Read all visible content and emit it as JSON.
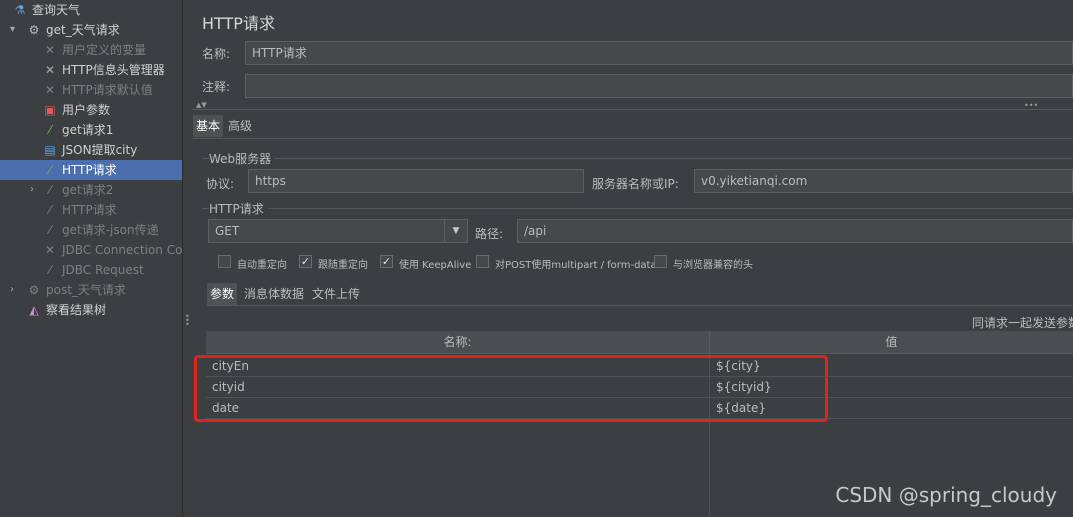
{
  "tree": {
    "items": [
      {
        "label": "查询天气",
        "icon": "flask-icon",
        "level": 0,
        "arrow": "",
        "state": "normal"
      },
      {
        "label": "get_天气请求",
        "icon": "gear-icon",
        "level": 1,
        "arrow": "▾",
        "state": "normal"
      },
      {
        "label": "用户定义的变量",
        "icon": "wrench-icon",
        "level": 2,
        "arrow": "",
        "state": "disabled"
      },
      {
        "label": "HTTP信息头管理器",
        "icon": "wrench-icon",
        "level": 2,
        "arrow": "",
        "state": "normal"
      },
      {
        "label": "HTTP请求默认值",
        "icon": "wrench-icon",
        "level": 2,
        "arrow": "",
        "state": "disabled"
      },
      {
        "label": "用户参数",
        "icon": "preprocessor-icon",
        "level": 2,
        "arrow": "",
        "state": "normal"
      },
      {
        "label": "get请求1",
        "icon": "pipette-icon",
        "level": 2,
        "arrow": "",
        "state": "normal"
      },
      {
        "label": "JSON提取city",
        "icon": "extractor-icon",
        "level": 2,
        "arrow": "",
        "state": "normal"
      },
      {
        "label": "HTTP请求",
        "icon": "pipette-icon",
        "level": 2,
        "arrow": "",
        "state": "selected"
      },
      {
        "label": "get请求2",
        "icon": "pipette-icon",
        "level": 2,
        "arrow": "›",
        "state": "disabled"
      },
      {
        "label": "HTTP请求",
        "icon": "pipette-icon",
        "level": 2,
        "arrow": "",
        "state": "disabled"
      },
      {
        "label": "get请求-json传递",
        "icon": "pipette-icon",
        "level": 2,
        "arrow": "",
        "state": "disabled"
      },
      {
        "label": "JDBC Connection Co",
        "icon": "wrench-icon",
        "level": 2,
        "arrow": "",
        "state": "disabled"
      },
      {
        "label": "JDBC Request",
        "icon": "pipette-icon",
        "level": 2,
        "arrow": "",
        "state": "disabled"
      },
      {
        "label": "post_天气请求",
        "icon": "gear-icon",
        "level": 1,
        "arrow": "›",
        "state": "disabled"
      },
      {
        "label": "察看结果树",
        "icon": "chart-icon",
        "level": 1,
        "arrow": "",
        "state": "normal"
      }
    ]
  },
  "main": {
    "title": "HTTP请求",
    "name_label": "名称:",
    "name_value": "HTTP请求",
    "comment_label": "注释:",
    "comment_value": "",
    "collapse_arrows": "▲▼",
    "more_dots": "•••",
    "tabs": [
      {
        "label": "基本"
      },
      {
        "label": "高级"
      }
    ],
    "web_server": {
      "title": "Web服务器",
      "protocol_label": "协议:",
      "protocol_value": "https",
      "server_label": "服务器名称或IP:",
      "server_value": "v0.yiketianqi.com"
    },
    "http_request": {
      "title": "HTTP请求",
      "method": "GET",
      "path_label": "路径:",
      "path_value": "/api"
    },
    "options": [
      {
        "label": "自动重定向",
        "checked": false
      },
      {
        "label": "跟随重定向",
        "checked": true
      },
      {
        "label": "使用 KeepAlive",
        "checked": true
      },
      {
        "label": "对POST使用multipart / form-data",
        "checked": false
      },
      {
        "label": "与浏览器兼容的头",
        "checked": false
      }
    ],
    "sub_tabs": [
      {
        "label": "参数"
      },
      {
        "label": "消息体数据"
      },
      {
        "label": "文件上传"
      }
    ],
    "send_with_request": "同请求一起发送参数",
    "params": {
      "headers": [
        "名称:",
        "值"
      ],
      "rows": [
        {
          "name": "cityEn",
          "value": "${city}"
        },
        {
          "name": "cityid",
          "value": "${cityid}"
        },
        {
          "name": "date",
          "value": "${date}"
        }
      ]
    }
  },
  "watermark": "CSDN @spring_cloudy",
  "colors": {
    "selection": "#4b6eaf",
    "highlight": "#e0231b",
    "background": "#3c3f41"
  }
}
